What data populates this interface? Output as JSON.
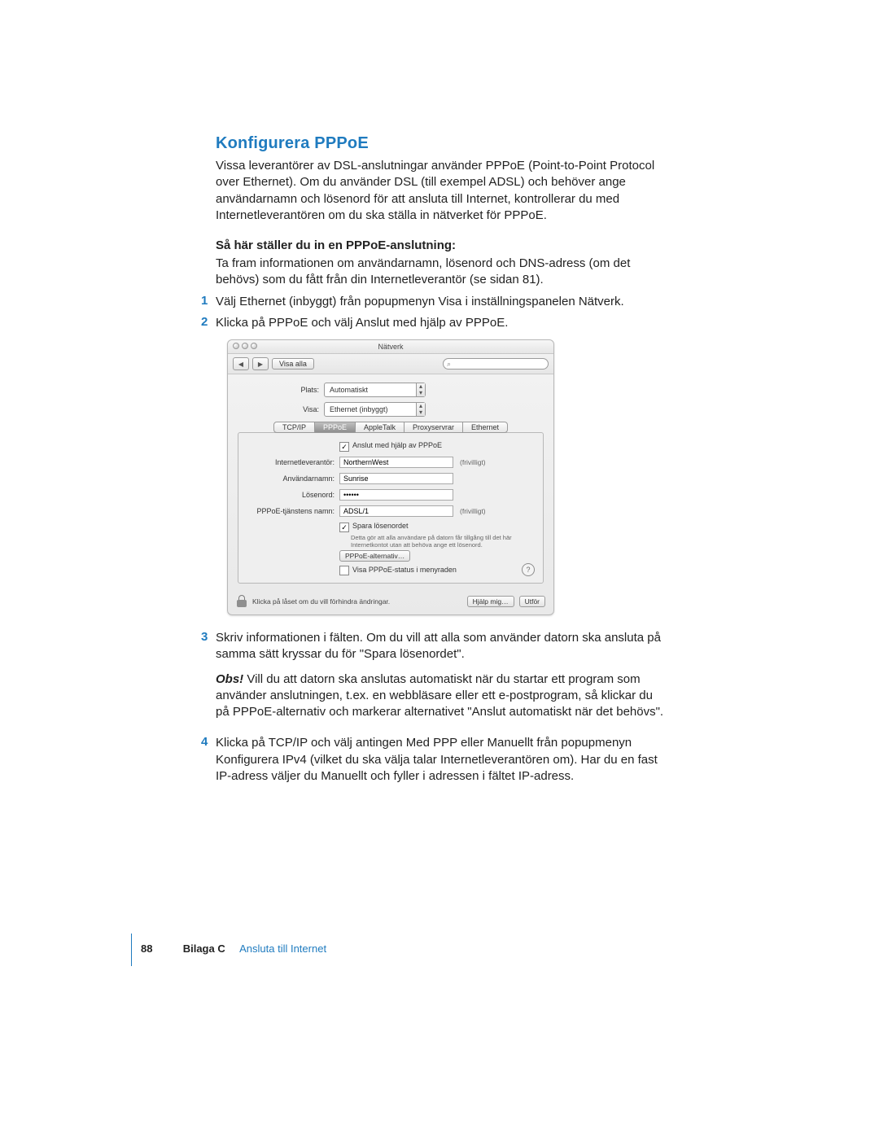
{
  "section": {
    "title": "Konfigurera PPPoE"
  },
  "intro": "Vissa leverantörer av DSL-anslutningar använder PPPoE (Point-to-Point Protocol over Ethernet). Om du använder DSL (till exempel ADSL) och behöver ange användarnamn och lösenord för att ansluta till Internet, kontrollerar du med Internetleverantören om du ska ställa in nätverket för PPPoE.",
  "steps_heading": "Så här ställer du in en PPPoE-anslutning:",
  "steps_intro": "Ta fram informationen om användarnamn, lösenord och DNS-adress (om det behövs) som du fått från din Internetleverantör (se sidan 81).",
  "step1": "Välj Ethernet (inbyggt) från popupmenyn Visa i inställningspanelen Nätverk.",
  "step2": "Klicka på PPPoE och välj Anslut med hjälp av PPPoE.",
  "step3": "Skriv informationen i fälten. Om du vill att alla som använder datorn ska ansluta på samma sätt kryssar du för \"Spara lösenordet\".",
  "obs_lead": "Obs!",
  "obs": " Vill du att datorn ska anslutas automatiskt när du startar ett program som använder anslutningen, t.ex. en webbläsare eller ett e-postprogram, så klickar du på PPPoE-alternativ och markerar alternativet \"Anslut automatiskt när det behövs\".",
  "step4": "Klicka på TCP/IP och välj antingen Med PPP eller Manuellt från popupmenyn Konfigurera IPv4 (vilket du ska välja talar Internetleverantören om). Har du en fast IP-adress väljer du Manuellt och fyller i adressen i fältet IP-adress.",
  "ui": {
    "window_title": "Nätverk",
    "toolbar": {
      "show_all": "Visa alla"
    },
    "labels": {
      "plats": "Plats:",
      "visa": "Visa:",
      "isp": "Internetleverantör:",
      "user": "Användarnamn:",
      "pass": "Lösenord:",
      "service": "PPPoE-tjänstens namn:",
      "optional": "(frivilligt)"
    },
    "selects": {
      "plats": "Automatiskt",
      "visa": "Ethernet (inbyggt)"
    },
    "tabs": {
      "t1": "TCP/IP",
      "t2": "PPPoE",
      "t3": "AppleTalk",
      "t4": "Proxyservrar",
      "t5": "Ethernet"
    },
    "checks": {
      "connect": "Anslut med hjälp av PPPoE",
      "save_pw": "Spara lösenordet",
      "menu": "Visa PPPoE-status i menyraden"
    },
    "values": {
      "isp": "NorthernWest",
      "user": "Sunrise",
      "pass": "••••••",
      "service": "ADSL/1"
    },
    "note": "Detta gör att alla användare på datorn får tillgång till det här Internetkontot utan att behöva ange ett lösenord.",
    "buttons": {
      "pppoe_alt": "PPPoE-alternativ…",
      "help_me": "Hjälp mig…",
      "apply": "Utför"
    },
    "lock_text": "Klicka på låset om du vill förhindra ändringar."
  },
  "footer": {
    "page": "88",
    "bilaga": "Bilaga C",
    "title": "Ansluta till Internet"
  }
}
